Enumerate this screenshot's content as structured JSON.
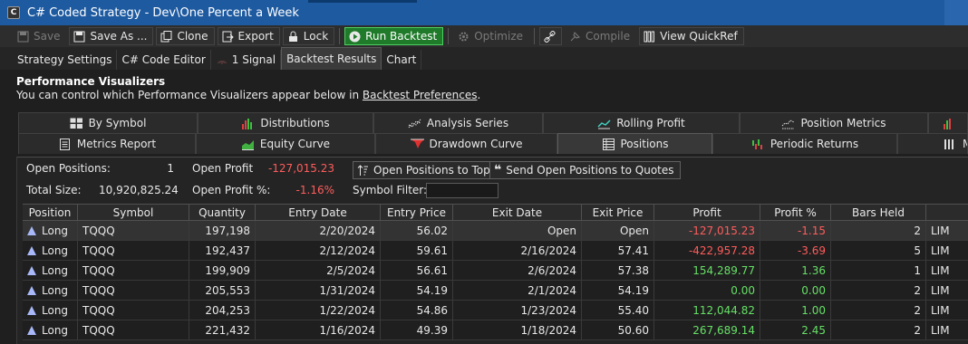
{
  "window": {
    "title": "C# Coded Strategy - Dev\\One Percent a Week"
  },
  "toolbar": {
    "save": "Save",
    "save_as": "Save As ...",
    "clone": "Clone",
    "export": "Export",
    "lock": "Lock",
    "run_backtest": "Run Backtest",
    "optimize": "Optimize",
    "compile": "Compile",
    "view_quickref": "View QuickRef"
  },
  "tabs": {
    "strategy_settings": "Strategy Settings",
    "code_editor": "C# Code Editor",
    "signal": "1 Signal",
    "backtest_results": "Backtest Results",
    "chart": "Chart"
  },
  "pv": {
    "title": "Performance Visualizers",
    "desc_pre": "You can control which Performance Visualizers appear below in ",
    "desc_link": "Backtest Preferences",
    "desc_post": "."
  },
  "vtabs_row1": [
    "By Symbol",
    "Distributions",
    "Analysis Series",
    "Rolling Profit",
    "Position Metrics"
  ],
  "vtabs_row2": [
    "Metrics Report",
    "Equity Curve",
    "Drawdown Curve",
    "Positions",
    "Periodic Returns",
    "M"
  ],
  "summary": {
    "open_positions_label": "Open Positions:",
    "open_positions_value": "1",
    "open_profit_label": "Open Profit",
    "open_profit_value": "-127,015.23",
    "total_size_label": "Total Size:",
    "total_size_value": "10,920,825.24",
    "open_profit_pct_label": "Open Profit %:",
    "open_profit_pct_value": "-1.16%",
    "symbol_filter_label": "Symbol Filter:",
    "open_positions_to_top": "Open Positions to Top",
    "send_open_positions": "Send Open Positions to Quotes"
  },
  "grid": {
    "columns": [
      "Position",
      "Symbol",
      "Quantity",
      "Entry Date",
      "Entry Price",
      "Exit Date",
      "Exit Price",
      "Profit",
      "Profit %",
      "Bars Held",
      ""
    ],
    "rows": [
      [
        "Long",
        "TQQQ",
        "197,198",
        "2/20/2024",
        "56.02",
        "Open",
        "Open",
        "-127,015.23",
        "-1.15",
        "2",
        "LIM"
      ],
      [
        "Long",
        "TQQQ",
        "192,437",
        "2/12/2024",
        "59.61",
        "2/16/2024",
        "57.41",
        "-422,957.28",
        "-3.69",
        "5",
        "LIM"
      ],
      [
        "Long",
        "TQQQ",
        "199,909",
        "2/5/2024",
        "56.61",
        "2/6/2024",
        "57.38",
        "154,289.77",
        "1.36",
        "1",
        "LIM"
      ],
      [
        "Long",
        "TQQQ",
        "205,553",
        "1/31/2024",
        "54.19",
        "2/1/2024",
        "54.19",
        "0.00",
        "0.00",
        "2",
        "LIM"
      ],
      [
        "Long",
        "TQQQ",
        "204,253",
        "1/22/2024",
        "54.86",
        "1/23/2024",
        "55.40",
        "112,044.82",
        "1.00",
        "2",
        "LIM"
      ],
      [
        "Long",
        "TQQQ",
        "221,432",
        "1/16/2024",
        "49.39",
        "1/18/2024",
        "50.60",
        "267,689.14",
        "2.45",
        "2",
        "LIM"
      ]
    ]
  },
  "colors": {
    "negative": "#ff5c5c",
    "positive": "#66e066",
    "title_bar": "#1e5aa0",
    "run_button": "#1f7a2a"
  }
}
